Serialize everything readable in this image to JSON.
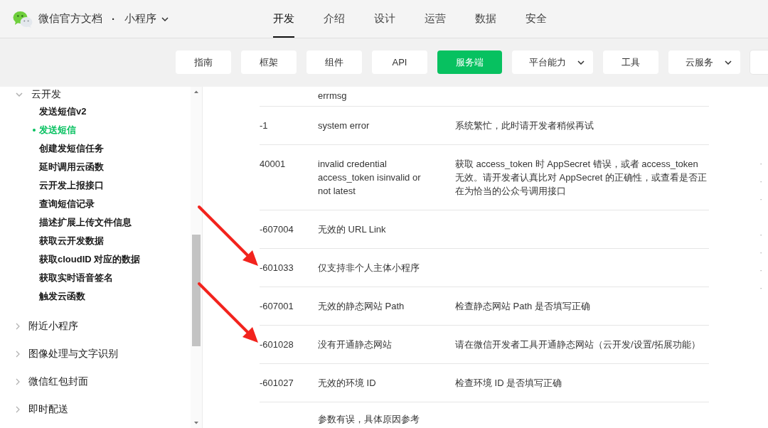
{
  "header": {
    "site_title": "微信官方文档",
    "separator": "·",
    "product": "小程序",
    "nav": [
      {
        "label": "开发",
        "selected": true
      },
      {
        "label": "介绍",
        "selected": false
      },
      {
        "label": "设计",
        "selected": false
      },
      {
        "label": "运营",
        "selected": false
      },
      {
        "label": "数据",
        "selected": false
      },
      {
        "label": "安全",
        "selected": false
      }
    ]
  },
  "subnav": [
    {
      "label": "指南",
      "selected": false,
      "has_menu": false
    },
    {
      "label": "框架",
      "selected": false,
      "has_menu": false
    },
    {
      "label": "组件",
      "selected": false,
      "has_menu": false
    },
    {
      "label": "API",
      "selected": false,
      "has_menu": false
    },
    {
      "label": "服务端",
      "selected": true,
      "has_menu": false
    },
    {
      "label": "平台能力",
      "selected": false,
      "has_menu": true
    },
    {
      "label": "工具",
      "selected": false,
      "has_menu": false
    },
    {
      "label": "云服务",
      "selected": false,
      "has_menu": true
    },
    {
      "selected": false,
      "has_menu": false
    }
  ],
  "sidebar": {
    "groups": [
      {
        "label": "云开发",
        "expanded": true,
        "children": [
          {
            "label": "发送短信v2",
            "selected": false
          },
          {
            "label": "发送短信",
            "selected": true
          },
          {
            "label": "创建发短信任务",
            "selected": false
          },
          {
            "label": "延时调用云函数",
            "selected": false
          },
          {
            "label": "云开发上报接口",
            "selected": false
          },
          {
            "label": "查询短信记录",
            "selected": false
          },
          {
            "label": "描述扩展上传文件信息",
            "selected": false
          },
          {
            "label": "获取云开发数据",
            "selected": false
          },
          {
            "label": "获取cloudID 对应的数据",
            "selected": false
          },
          {
            "label": "获取实时语音签名",
            "selected": false
          },
          {
            "label": "触发云函数",
            "selected": false
          }
        ]
      },
      {
        "label": "附近小程序",
        "expanded": false
      },
      {
        "label": "图像处理与文字识别",
        "expanded": false
      },
      {
        "label": "微信红包封面",
        "expanded": false
      },
      {
        "label": "即时配送",
        "expanded": false
      }
    ]
  },
  "table": {
    "rows": [
      {
        "message": "errmsg",
        "marked": false
      },
      {
        "code": "-1",
        "message": "system error",
        "description": "系统繁忙，此时请开发者稍候再试",
        "marked": false
      },
      {
        "code": "40001",
        "message": "invalid credential access_token isinvalid or not latest",
        "description": "获取 access_token 时 AppSecret 错误，或者 access_token 无效。请开发者认真比对 AppSecret 的正确性，或查看是否正在为恰当的公众号调用接口",
        "marked": false
      },
      {
        "code": "-607004",
        "message": "无效的 URL Link",
        "marked": false
      },
      {
        "code": "-601033",
        "message": "仅支持非个人主体小程序",
        "marked": true
      },
      {
        "code": "-607001",
        "message": "无效的静态网站 Path",
        "description": "检查静态网站 Path 是否填写正确",
        "marked": false
      },
      {
        "code": "-601028",
        "message": "没有开通静态网站",
        "description": "请在微信开发者工具开通静态网站（云开发/设置/拓展功能）",
        "marked": true
      },
      {
        "code": "-601027",
        "message": "无效的环境 ID",
        "description": "检查环境 ID 是否填写正确",
        "marked": false
      },
      {
        "message": "参数有误，具体原因参考",
        "marked": false
      }
    ]
  },
  "outline": {
    "sections": [
      {
        "items": [
          "·",
          "·",
          "·"
        ]
      },
      {
        "items": [
          "·",
          "·",
          "·",
          "·"
        ]
      }
    ]
  }
}
